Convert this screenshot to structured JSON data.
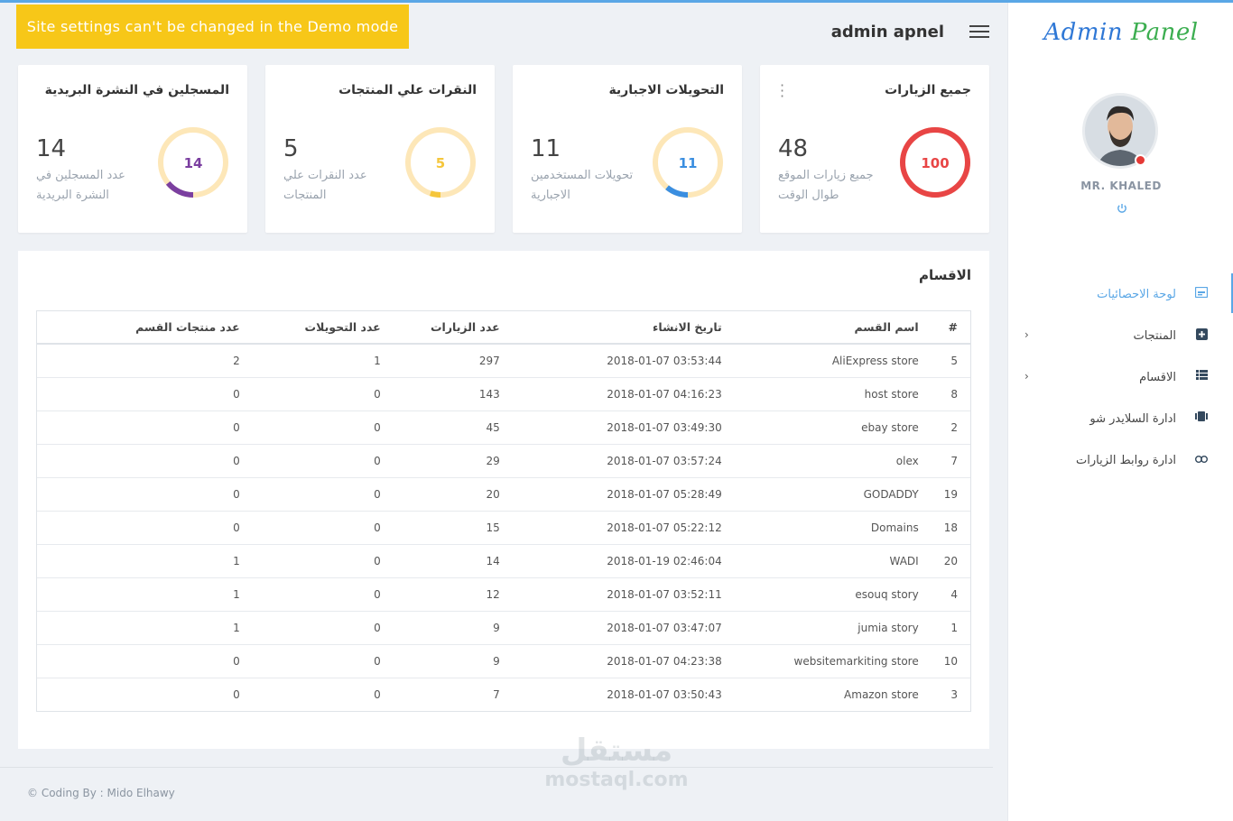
{
  "banner": {
    "text": "Site settings can't be changed in the Demo mode",
    "color": "#f7c718"
  },
  "header": {
    "title": "admin apnel"
  },
  "sidebar": {
    "logo_part1": "Admin",
    "logo_part2": "Panel",
    "username": "MR. KHALED",
    "items": [
      {
        "label": "لوحة الاحصائيات",
        "icon": "dashboard-icon",
        "active": true
      },
      {
        "label": "المنتجات",
        "icon": "plus-box-icon",
        "has_children": true
      },
      {
        "label": "الاقسام",
        "icon": "list-icon",
        "has_children": true
      },
      {
        "label": "ادارة السلايدر شو",
        "icon": "slides-icon"
      },
      {
        "label": "ادارة روابط الزيارات",
        "icon": "link-icon"
      }
    ]
  },
  "cards": [
    {
      "title": "جميع الزيارات",
      "number": "48",
      "desc": "جميع زيارات الموقع طوال الوقت",
      "ring_value": "100",
      "ring_fraction": 1.0,
      "ring_color": "#e84545"
    },
    {
      "title": "التحويلات الاجبارية",
      "number": "11",
      "desc": "تحويلات المستخدمين الاجبارية",
      "ring_value": "11",
      "ring_fraction": 0.11,
      "ring_color": "#3a8ee0"
    },
    {
      "title": "النقرات علي المنتجات",
      "number": "5",
      "desc": "عدد النقرات علي المنتجات",
      "ring_value": "5",
      "ring_fraction": 0.05,
      "ring_color": "#f5c63b"
    },
    {
      "title": "المسجلين في النشرة البريدية",
      "number": "14",
      "desc": "عدد المسجلين في النشرة البريدية",
      "ring_value": "14",
      "ring_fraction": 0.14,
      "ring_color": "#7b3fa0"
    }
  ],
  "table": {
    "title": "الاقسام",
    "headers": [
      "#",
      "اسم القسم",
      "تاريخ الانشاء",
      "عدد الزيارات",
      "عدد التحويلات",
      "عدد منتجات القسم"
    ],
    "rows": [
      [
        "5",
        "AliExpress store",
        "2018-01-07 03:53:44",
        "297",
        "1",
        "2"
      ],
      [
        "8",
        "host store",
        "2018-01-07 04:16:23",
        "143",
        "0",
        "0"
      ],
      [
        "2",
        "ebay store",
        "2018-01-07 03:49:30",
        "45",
        "0",
        "0"
      ],
      [
        "7",
        "olex",
        "2018-01-07 03:57:24",
        "29",
        "0",
        "0"
      ],
      [
        "19",
        "GODADDY",
        "2018-01-07 05:28:49",
        "20",
        "0",
        "0"
      ],
      [
        "18",
        "Domains",
        "2018-01-07 05:22:12",
        "15",
        "0",
        "0"
      ],
      [
        "20",
        "WADI",
        "2018-01-19 02:46:04",
        "14",
        "0",
        "1"
      ],
      [
        "4",
        "esouq story",
        "2018-01-07 03:52:11",
        "12",
        "0",
        "1"
      ],
      [
        "1",
        "jumia story",
        "2018-01-07 03:47:07",
        "9",
        "0",
        "1"
      ],
      [
        "10",
        "websitemarkiting store",
        "2018-01-07 04:23:38",
        "9",
        "0",
        "0"
      ],
      [
        "3",
        "Amazon store",
        "2018-01-07 03:50:43",
        "7",
        "0",
        "0"
      ]
    ]
  },
  "footer": {
    "text": "© Coding By : Mido Elhawy"
  },
  "watermark": {
    "line1": "مستقل",
    "line2": "mostaql.com"
  },
  "colors": {
    "accent": "#5aa7e6",
    "ring_track": "#fde7b8"
  }
}
